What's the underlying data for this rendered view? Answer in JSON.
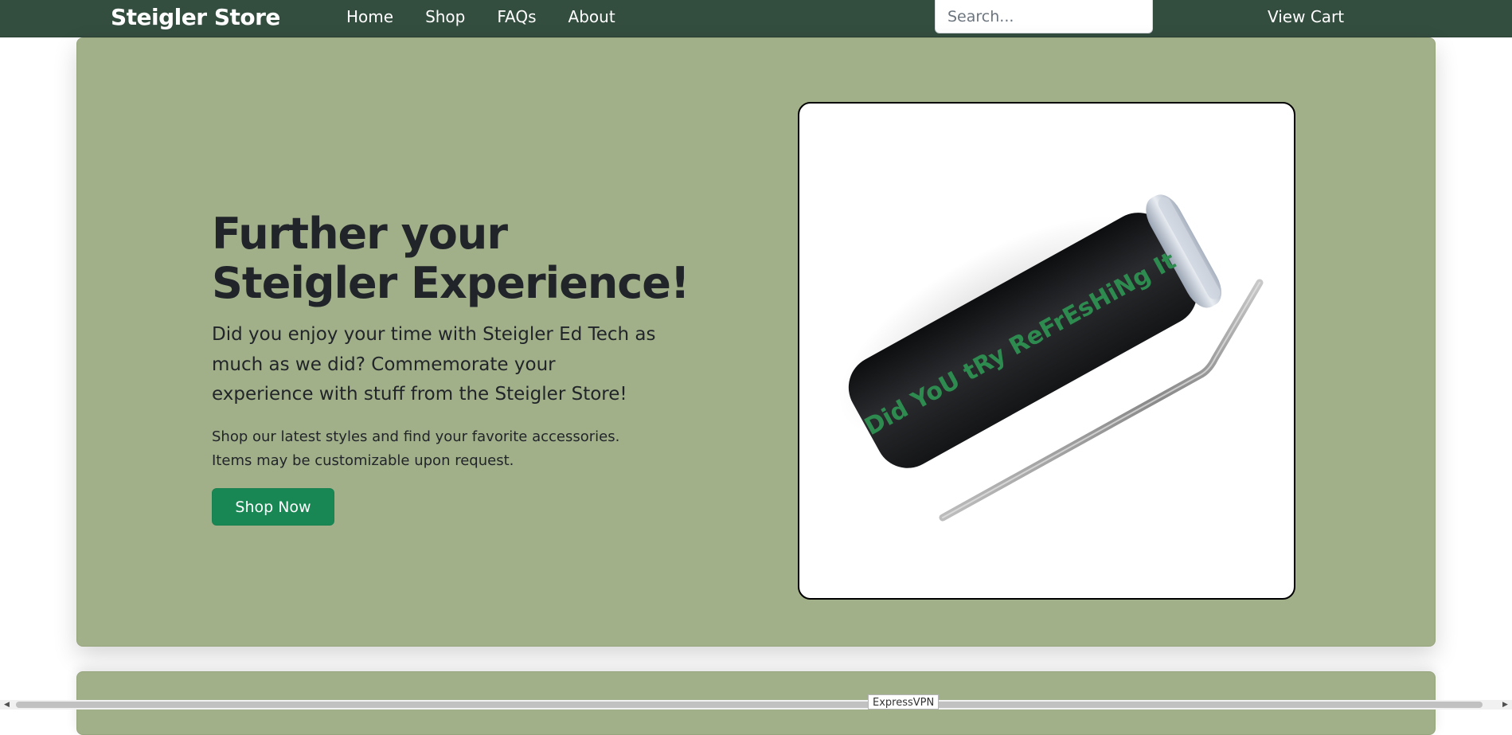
{
  "navbar": {
    "brand": "Steigler Store",
    "links": [
      {
        "label": "Home"
      },
      {
        "label": "Shop"
      },
      {
        "label": "FAQs"
      },
      {
        "label": "About"
      }
    ],
    "search": {
      "placeholder": "Search...",
      "value": ""
    },
    "cart_label": "View Cart"
  },
  "hero": {
    "title": "Further your Steigler Experience!",
    "lead": "Did you enjoy your time with Steigler Ed Tech as much as we did? Commemorate your experience with stuff from the Steigler Store!",
    "text": "Shop our latest styles and find your favorite accessories. Items may be customizable upon request.",
    "button_label": "Shop Now",
    "product_image": {
      "description_text": "Did YoU tRy ReFrEsHiNg It",
      "tumbler_color": "#1d1e20",
      "text_color": "#2e8b50"
    }
  },
  "colors": {
    "navbar_bg": "#334d3f",
    "hero_bg": "#a2b08a",
    "button_bg": "#198754"
  },
  "tooltip": {
    "label": "ExpressVPN"
  }
}
